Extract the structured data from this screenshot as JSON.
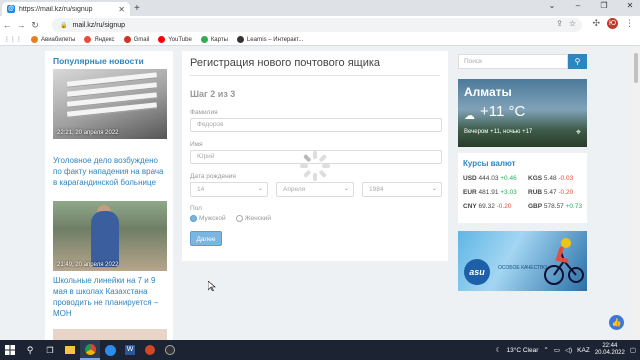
{
  "browser": {
    "tab_title": "https://mail.kz/ru/signup",
    "url": "mail.kz/ru/signup",
    "bookmarks": [
      {
        "label": "Авиабилеты",
        "color": "#e67e22"
      },
      {
        "label": "Яндекс",
        "color": "#e74c3c"
      },
      {
        "label": "Gmail",
        "color": "#d93025"
      },
      {
        "label": "YouTube",
        "color": "#ff0000"
      },
      {
        "label": "Карты",
        "color": "#34a853"
      },
      {
        "label": "Learnis – Интеракт...",
        "color": "#333333"
      }
    ],
    "profile_initial": "Ю"
  },
  "left": {
    "section_title": "Популярные новости",
    "news": [
      {
        "time": "22:21, 20 апреля 2022",
        "text": "Уголовное дело возбуждено по факту нападения на врача в карагандинской больнице"
      },
      {
        "time": "21:49, 20 апреля 2022",
        "text": "Школьные линейки на 7 и 9 мая в школах Казахстана проводить не планируется – МОН"
      }
    ]
  },
  "form": {
    "title": "Регистрация нового почтового ящика",
    "step": "Шаг 2 из 3",
    "surname_label": "Фамилия",
    "surname_value": "Федоров",
    "name_label": "Имя",
    "name_value": "Юрий",
    "birth_label": "Дата рождения",
    "day": "14",
    "month": "Апреля",
    "year": "1984",
    "gender_label": "Пол",
    "male": "Мужской",
    "female": "Женский",
    "next_button": "Далее"
  },
  "right": {
    "search_placeholder": "Поиск",
    "city": "Алматы",
    "temperature": "+11 °C",
    "forecast": "Вечером +11, ночью +17",
    "rates_title": "Курсы валют",
    "rates": [
      {
        "code": "USD",
        "value": "444.03",
        "change": "+0.46",
        "dir": "up"
      },
      {
        "code": "KGS",
        "value": "5.48",
        "change": "-0.03",
        "dir": "down"
      },
      {
        "code": "EUR",
        "value": "481.91",
        "change": "+3.03",
        "dir": "up"
      },
      {
        "code": "RUB",
        "value": "5.47",
        "change": "-0.20",
        "dir": "down"
      },
      {
        "code": "CNY",
        "value": "69.32",
        "change": "-0.20",
        "dir": "down"
      },
      {
        "code": "GBP",
        "value": "578.57",
        "change": "+0.73",
        "dir": "up"
      }
    ],
    "ad_brand": "asu",
    "ad_slogan": "ОСОБОЕ КАЧЕСТВО"
  },
  "taskbar": {
    "weather": "13°C  Clear",
    "lang": "KAZ",
    "time": "22:44",
    "date": "20.04.2022"
  }
}
